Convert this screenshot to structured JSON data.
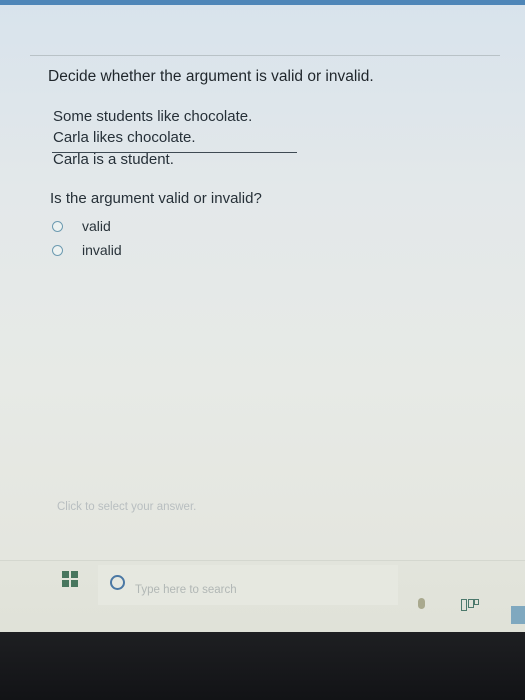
{
  "question": {
    "title": "Decide whether the argument is valid or invalid.",
    "premises": [
      "Some students like chocolate.",
      "Carla likes chocolate."
    ],
    "conclusion": "Carla is a student.",
    "prompt": "Is the argument valid or invalid?",
    "options": [
      {
        "label": "valid",
        "selected": false
      },
      {
        "label": "invalid",
        "selected": false
      }
    ],
    "hint": "Click to select your answer."
  },
  "taskbar": {
    "search_placeholder": "Type here to search"
  },
  "colors": {
    "accent": "#4e86b8",
    "radio_border": "#6d9bb1",
    "start_icon": "#48765e"
  }
}
